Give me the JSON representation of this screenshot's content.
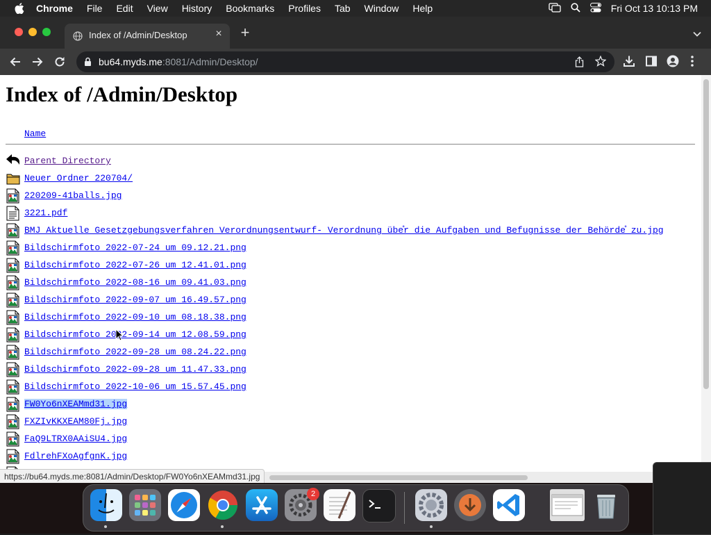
{
  "menubar": {
    "app": "Chrome",
    "items": [
      "File",
      "Edit",
      "View",
      "History",
      "Bookmarks",
      "Profiles",
      "Tab",
      "Window",
      "Help"
    ],
    "clock": "Fri Oct 13  10:13 PM"
  },
  "tab": {
    "title": "Index of /Admin/Desktop"
  },
  "omnibox": {
    "host": "bu64.myds.me",
    "path": ":8081/Admin/Desktop/"
  },
  "page": {
    "heading": "Index of /Admin/Desktop",
    "column_name": "Name",
    "entries": [
      {
        "label": "Parent Directory",
        "icon": "back-icon",
        "visited": true
      },
      {
        "label": "Neuer Ordner 220704/",
        "icon": "folder-icon"
      },
      {
        "label": "220209-41balls.jpg",
        "icon": "image-icon"
      },
      {
        "label": "3221.pdf",
        "icon": "text-icon"
      },
      {
        "label": "BMJ  Aktuelle Gesetzgebungsverfahren  Verordnungsentwurf- Verordnung übe̊r die Aufgaben und Befugnisse der Behörde̊ zu.jpg",
        "icon": "image-icon"
      },
      {
        "label": "Bildschirmfoto 2022-07-24 um 09.12.21.png",
        "icon": "image-icon"
      },
      {
        "label": "Bildschirmfoto 2022-07-26 um 12.41.01.png",
        "icon": "image-icon"
      },
      {
        "label": "Bildschirmfoto 2022-08-16 um 09.41.03.png",
        "icon": "image-icon"
      },
      {
        "label": "Bildschirmfoto 2022-09-07 um 16.49.57.png",
        "icon": "image-icon"
      },
      {
        "label": "Bildschirmfoto 2022-09-10 um 08.18.38.png",
        "icon": "image-icon"
      },
      {
        "label": "Bildschirmfoto 2022-09-14 um 12.08.59.png",
        "icon": "image-icon"
      },
      {
        "label": "Bildschirmfoto 2022-09-28 um 08.24.22.png",
        "icon": "image-icon"
      },
      {
        "label": "Bildschirmfoto 2022-09-28 um 11.47.33.png",
        "icon": "image-icon"
      },
      {
        "label": "Bildschirmfoto 2022-10-06 um 15.57.45.png",
        "icon": "image-icon"
      },
      {
        "label": "FW0Yo6nXEAMmd31.jpg",
        "icon": "image-icon",
        "selected": true
      },
      {
        "label": "FXZIvKKXEAM80Fj.jpg",
        "icon": "image-icon"
      },
      {
        "label": "FaQ9LTRX0AAiSU4.jpg",
        "icon": "image-icon"
      },
      {
        "label": "FdlrehFXoAgfgnK.jpg",
        "icon": "image-icon"
      },
      {
        "label": "",
        "icon": "image-icon"
      }
    ]
  },
  "status_url": "https://bu64.myds.me:8081/Admin/Desktop/FW0Yo6nXEAMmd31.jpg",
  "dock": {
    "badge": "2",
    "apps": [
      "finder-icon",
      "launchpad-icon",
      "safari-icon",
      "chrome-icon",
      "app-store-icon",
      "system-settings-icon",
      "textedit-icon",
      "terminal-icon",
      "system-preferences-icon",
      "downloads-icon",
      "vscode-icon",
      "preview-window-icon",
      "trash-icon"
    ]
  },
  "colors": {
    "link": "#0000ee",
    "visited": "#551a8b",
    "selection": "#b3d4fc",
    "menubar": "#262626",
    "toolbar": "#3b3b3b"
  }
}
